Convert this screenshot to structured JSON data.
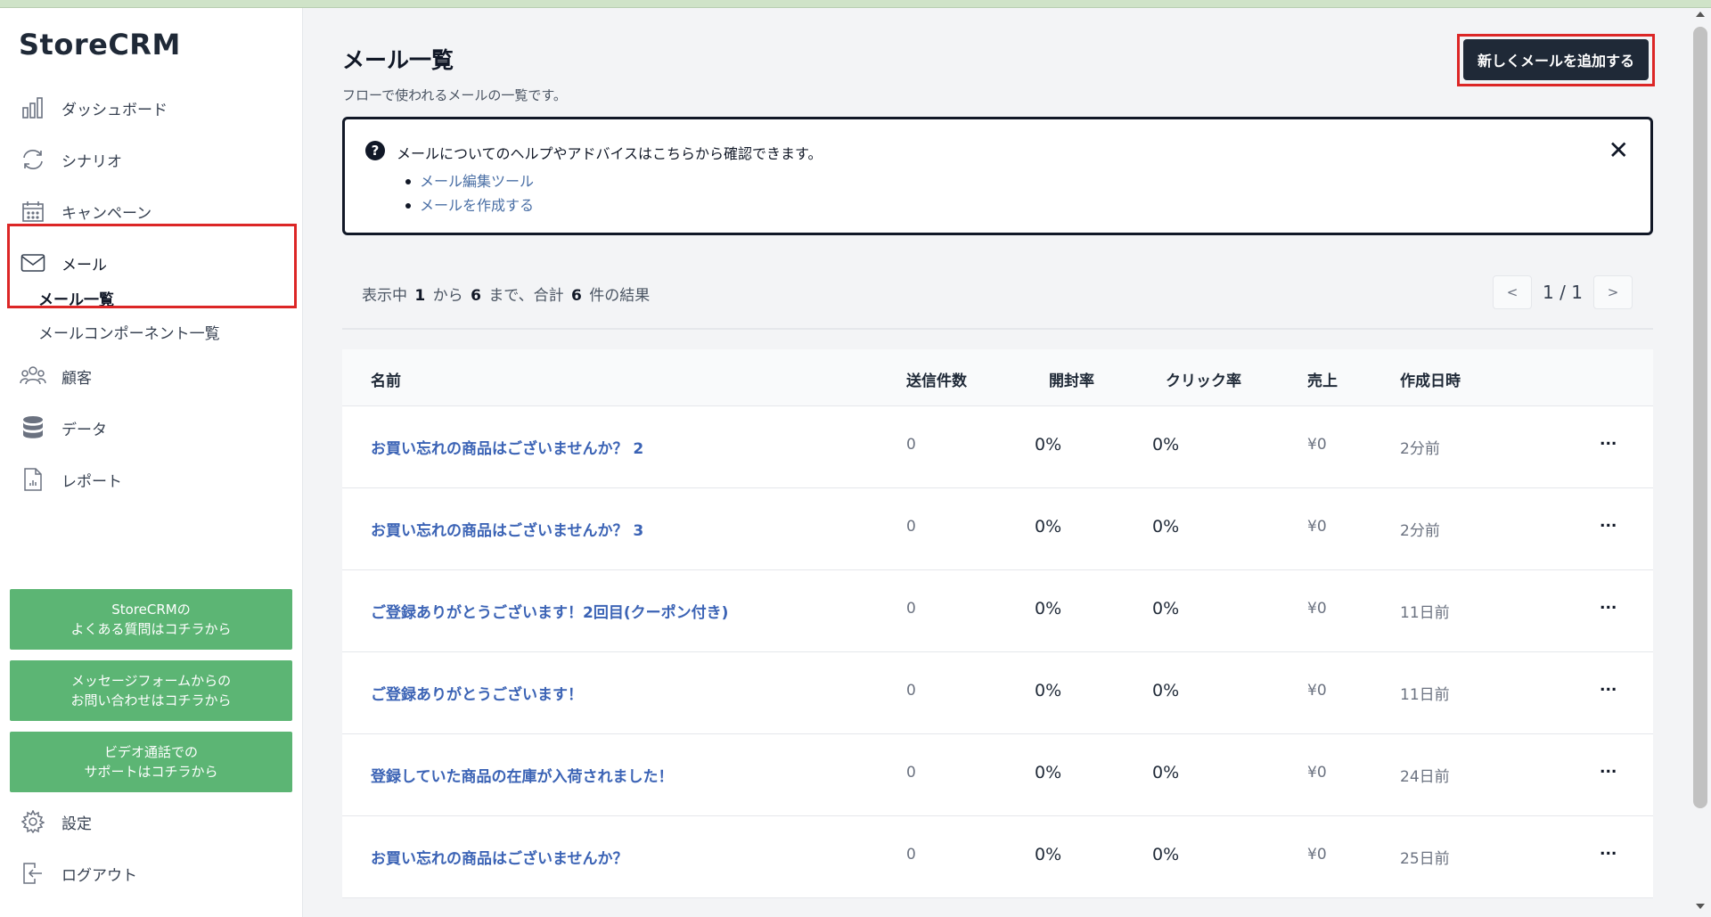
{
  "app": {
    "logo": "StoreCRM"
  },
  "sidebar": {
    "items": [
      {
        "label": "ダッシュボード",
        "icon": "bar-chart-icon"
      },
      {
        "label": "シナリオ",
        "icon": "refresh-icon"
      },
      {
        "label": "キャンペーン",
        "icon": "calendar-icon"
      },
      {
        "label": "メール",
        "icon": "mail-icon"
      },
      {
        "label": "顧客",
        "icon": "users-icon"
      },
      {
        "label": "データ",
        "icon": "database-icon"
      },
      {
        "label": "レポート",
        "icon": "report-icon"
      }
    ],
    "mail_sub": {
      "active": "メール一覧",
      "other": "メールコンポーネント一覧"
    },
    "support": [
      {
        "line1": "StoreCRMの",
        "line2": "よくある質問はコチラから"
      },
      {
        "line1": "メッセージフォームからの",
        "line2": "お問い合わせはコチラから"
      },
      {
        "line1": "ビデオ通話での",
        "line2": "サポートはコチラから"
      }
    ],
    "settings": "設定",
    "logout": "ログアウト"
  },
  "header": {
    "title": "メール一覧",
    "subtitle": "フローで使われるメールの一覧です。",
    "add_button": "新しくメールを追加する"
  },
  "help": {
    "title": "メールについてのヘルプやアドバイスはこちらから確認できます。",
    "links": [
      "メール編集ツール",
      "メールを作成する"
    ],
    "close": "✕"
  },
  "results": {
    "prefix": "表示中",
    "from": "1",
    "from_word": "から",
    "to": "6",
    "to_word": "まで、合計",
    "total": "6",
    "suffix": "件の結果"
  },
  "pager": {
    "prev": "<",
    "page": "1 / 1",
    "next": ">"
  },
  "table": {
    "columns": [
      "名前",
      "送信件数",
      "開封率",
      "クリック率",
      "売上",
      "作成日時"
    ],
    "rows": [
      {
        "name": "お買い忘れの商品はございませんか？ 2",
        "sent": "0",
        "open": "0%",
        "click": "0%",
        "sales": "¥0",
        "date": "2分前",
        "more": "..."
      },
      {
        "name": "お買い忘れの商品はございませんか？ 3",
        "sent": "0",
        "open": "0%",
        "click": "0%",
        "sales": "¥0",
        "date": "2分前",
        "more": "..."
      },
      {
        "name": "ご登録ありがとうございます！2回目(クーポン付き)",
        "sent": "0",
        "open": "0%",
        "click": "0%",
        "sales": "¥0",
        "date": "11日前",
        "more": "..."
      },
      {
        "name": "ご登録ありがとうございます！",
        "sent": "0",
        "open": "0%",
        "click": "0%",
        "sales": "¥0",
        "date": "11日前",
        "more": "..."
      },
      {
        "name": "登録していた商品の在庫が入荷されました！",
        "sent": "0",
        "open": "0%",
        "click": "0%",
        "sales": "¥0",
        "date": "24日前",
        "more": "..."
      },
      {
        "name": "お買い忘れの商品はございませんか？",
        "sent": "0",
        "open": "0%",
        "click": "0%",
        "sales": "¥0",
        "date": "25日前",
        "more": "..."
      }
    ]
  },
  "colors": {
    "accent_dark": "#1f2937",
    "highlight_red": "#dc2626",
    "support_green": "#5cb574",
    "link_blue": "#3b63b5"
  }
}
